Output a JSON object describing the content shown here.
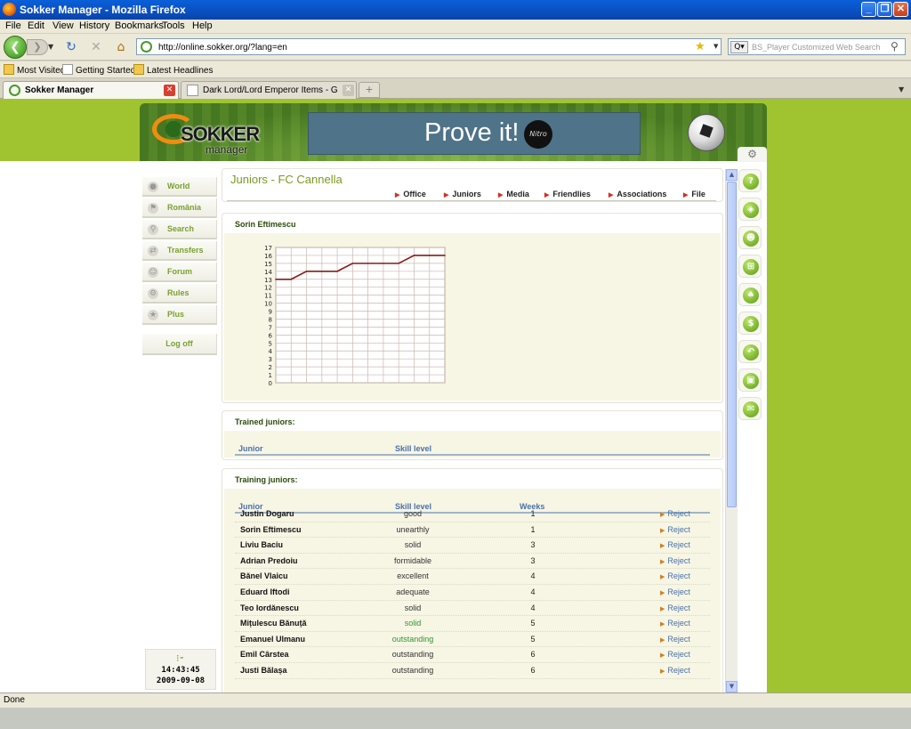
{
  "window": {
    "title": "Sokker Manager - Mozilla Firefox",
    "minimize": "_",
    "maximize": "❐",
    "close": "✕"
  },
  "menu": [
    "File",
    "Edit",
    "View",
    "History",
    "Bookmarks",
    "Tools",
    "Help"
  ],
  "nav": {
    "url": "http://online.sokker.org/?lang=en",
    "search_placeholder": "BS_Player Customized Web Search"
  },
  "bookmarks": [
    "Most Visited",
    "Getting Started",
    "Latest Headlines"
  ],
  "tabs": [
    {
      "label": "Sokker Manager",
      "active": true
    },
    {
      "label": "Dark Lord/Lord Emperor Items - Grudge...",
      "active": false
    }
  ],
  "site": {
    "logo_text": "SOKKER",
    "logo_sub": "manager",
    "ad_text": "Prove it!",
    "ad_badge": "Nitro"
  },
  "leftnav": [
    {
      "label": "World",
      "icon": "globe-icon"
    },
    {
      "label": "România",
      "icon": "flag-icon"
    },
    {
      "label": "Search",
      "icon": "magnifier-icon"
    },
    {
      "label": "Transfers",
      "icon": "transfer-icon"
    },
    {
      "label": "Forum",
      "icon": "people-icon"
    },
    {
      "label": "Rules",
      "icon": "gears-icon"
    },
    {
      "label": "Plus",
      "icon": "star-icon"
    }
  ],
  "logoff": "Log off",
  "clock": {
    "time": "14:43:45",
    "date": "2009-09-08"
  },
  "page": {
    "title": "Juniors - FC Cannella",
    "tabs": [
      "Office",
      "Juniors",
      "Media",
      "Friendlies",
      "Associations",
      "File"
    ]
  },
  "chart_panel_title": "Sorin Eftimescu",
  "chart_data": {
    "type": "line",
    "x": [
      0,
      1,
      2,
      3,
      4,
      5,
      6,
      7,
      8,
      9,
      10,
      11
    ],
    "series": [
      {
        "values": [
          13,
          13,
          14,
          14,
          14,
          15,
          15,
          15,
          15,
          16,
          16,
          16
        ],
        "color": "#8b1a1a"
      }
    ],
    "title": "",
    "xlabel": "",
    "ylabel": "",
    "ylim": [
      0,
      17
    ],
    "yticks": [
      0,
      1,
      2,
      3,
      4,
      5,
      6,
      7,
      8,
      9,
      10,
      11,
      12,
      13,
      14,
      15,
      16,
      17
    ],
    "grid": true
  },
  "trained": {
    "title": "Trained juniors:",
    "col_junior": "Junior",
    "col_skill": "Skill level"
  },
  "training": {
    "title": "Training juniors:",
    "col_junior": "Junior",
    "col_skill": "Skill level",
    "col_weeks": "Weeks",
    "rows": [
      {
        "name": "Justin Dogaru",
        "skill": "good",
        "weeks": "1",
        "action": "Reject"
      },
      {
        "name": "Sorin Eftimescu",
        "skill": "unearthly",
        "weeks": "1",
        "action": "Reject"
      },
      {
        "name": "Liviu Baciu",
        "skill": "solid",
        "weeks": "3",
        "action": "Reject"
      },
      {
        "name": "Adrian Predoiu",
        "skill": "formidable",
        "weeks": "3",
        "action": "Reject"
      },
      {
        "name": "Bănel Vlaicu",
        "skill": "excellent",
        "weeks": "4",
        "action": "Reject"
      },
      {
        "name": "Eduard Iftodi",
        "skill": "adequate",
        "weeks": "4",
        "action": "Reject"
      },
      {
        "name": "Teo Iordănescu",
        "skill": "solid",
        "weeks": "4",
        "action": "Reject"
      },
      {
        "name": "Mițulescu Bănuță",
        "skill": "solid",
        "weeks": "5",
        "action": "Reject",
        "highlight": true
      },
      {
        "name": "Emanuel Ulmanu",
        "skill": "outstanding",
        "weeks": "5",
        "action": "Reject",
        "highlight": true
      },
      {
        "name": "Emil Cârstea",
        "skill": "outstanding",
        "weeks": "6",
        "action": "Reject"
      },
      {
        "name": "Justi Bălașa",
        "skill": "outstanding",
        "weeks": "6",
        "action": "Reject"
      }
    ]
  },
  "status": "Done"
}
